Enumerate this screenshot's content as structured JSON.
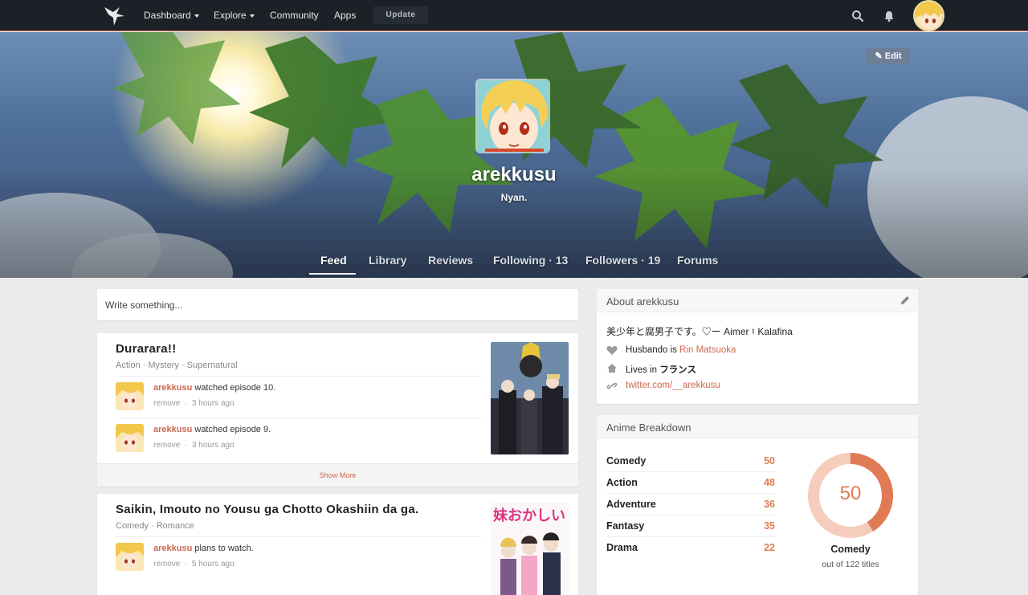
{
  "nav": {
    "logo": "hummingbird-logo",
    "items": [
      {
        "label": "Dashboard",
        "has_caret": true
      },
      {
        "label": "Explore",
        "has_caret": true
      },
      {
        "label": "Community",
        "has_caret": false
      },
      {
        "label": "Apps",
        "has_caret": false
      }
    ],
    "update_label": "Update",
    "search_icon": "search-icon",
    "notifications_icon": "bell-icon"
  },
  "profile": {
    "edit_label": "Edit",
    "username": "arekkusu",
    "bio": "Nyan.",
    "tabs": [
      {
        "label": "Feed",
        "active": true
      },
      {
        "label": "Library",
        "active": false
      },
      {
        "label": "Reviews",
        "active": false
      },
      {
        "label": "Following · 13",
        "active": false
      },
      {
        "label": "Followers · 19",
        "active": false
      },
      {
        "label": "Forums",
        "active": false
      }
    ]
  },
  "feed": {
    "write_placeholder": "Write something...",
    "cards": [
      {
        "title": "Durarara!!",
        "genres": "Action · Mystery · Supernatural",
        "activities": [
          {
            "user": "arekkusu",
            "action": " watched episode 10.",
            "remove": "remove",
            "time": "3 hours ago"
          },
          {
            "user": "arekkusu",
            "action": " watched episode 9.",
            "remove": "remove",
            "time": "3 hours ago"
          }
        ],
        "show_more": "Show More"
      },
      {
        "title": "Saikin, Imouto no Yousu ga Chotto Okashiin da ga.",
        "genres": "Comedy · Romance",
        "activities": [
          {
            "user": "arekkusu",
            "action": " plans to watch.",
            "remove": "remove",
            "time": "5 hours ago"
          }
        ]
      }
    ]
  },
  "about": {
    "header": "About arekkusu",
    "tagline": "美少年と腐男子です。♡ー Aimer ♮ Kalafina",
    "husbando_prefix": "Husbando is ",
    "husbando_name": "Rin Matsuoka",
    "lives_prefix": "Lives in ",
    "lives_place": "フランス",
    "website": "twitter.com/__arekkusu"
  },
  "breakdown": {
    "header": "Anime Breakdown",
    "rows": [
      {
        "label": "Comedy",
        "value": "50"
      },
      {
        "label": "Action",
        "value": "48"
      },
      {
        "label": "Adventure",
        "value": "36"
      },
      {
        "label": "Fantasy",
        "value": "35"
      },
      {
        "label": "Drama",
        "value": "22"
      }
    ],
    "donut_value": "50",
    "donut_fraction": 0.41,
    "donut_label": "Comedy",
    "donut_sub": "out of 122 titles",
    "accent": "#e07b55",
    "accent_light": "#f6cdbd"
  },
  "colors": {
    "brand": "#c8694f",
    "nav_bg": "#1c2128"
  }
}
